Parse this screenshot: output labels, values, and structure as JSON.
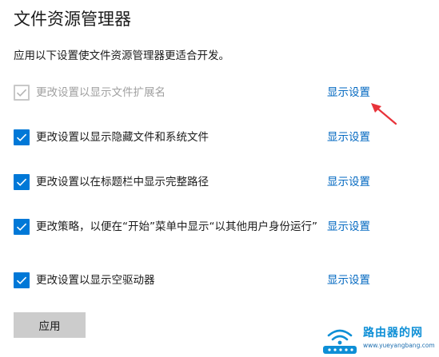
{
  "page": {
    "title": "文件资源管理器",
    "description": "应用以下设置使文件资源管理器更适合开发。"
  },
  "settings": [
    {
      "label": "更改设置以显示文件扩展名",
      "link": "显示设置",
      "checked": true,
      "enabled": false
    },
    {
      "label": "更改设置以显示隐藏文件和系统文件",
      "link": "显示设置",
      "checked": true,
      "enabled": true
    },
    {
      "label": "更改设置以在标题栏中显示完整路径",
      "link": "显示设置",
      "checked": true,
      "enabled": true
    },
    {
      "label": "更改策略，以便在“开始”菜单中显示“以其他用户身份运行”",
      "link": "显示设置",
      "checked": true,
      "enabled": true
    },
    {
      "label": "更改设置以显示空驱动器",
      "link": "显示设置",
      "checked": true,
      "enabled": true
    }
  ],
  "apply_button": {
    "label": "应用"
  },
  "annotation": {
    "arrow_color": "#e8333a"
  },
  "watermark": {
    "name": "路由器的网",
    "url": "www.yueyangbang.com",
    "color": "#0e8fd6"
  },
  "colors": {
    "accent": "#0078d7",
    "link": "#0067c0",
    "disabled_text": "#a0a0a0",
    "button_bg": "#cccccc"
  },
  "icons": {
    "checkbox_check": "checkmark-icon",
    "annotation": "red-arrow-icon",
    "watermark_logo": "wifi-router-icon"
  }
}
